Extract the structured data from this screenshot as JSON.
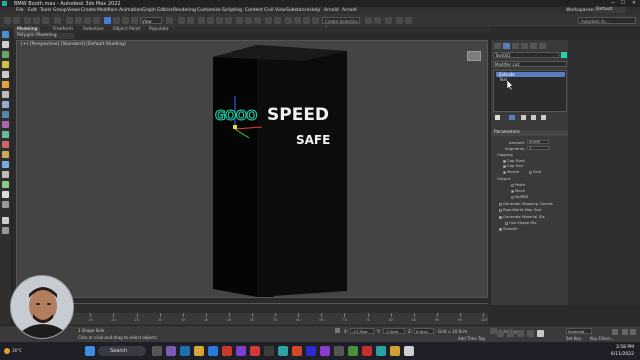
{
  "window": {
    "title": "BMW Booth.max - Autodesk 3ds Max 2022",
    "minimize": "—",
    "maximize": "☐",
    "close": "✕"
  },
  "menu": {
    "items": [
      "File",
      "Edit",
      "Tools",
      "Group",
      "Views",
      "Create",
      "Modifiers",
      "Animation",
      "Graph Editors",
      "Rendering",
      "Customize",
      "Scripting",
      "Content",
      "Civil View",
      "Substance",
      "Help",
      "Arnold",
      "Arnold"
    ],
    "workspaces_label": "Workspaces:",
    "workspaces_value": "Default"
  },
  "toolbar": {
    "view_dropdown": "View",
    "named_selection": "Create Selection Se",
    "search_placeholder": "Autodesk Ac..."
  },
  "ribbon": {
    "tabs": [
      "Modeling",
      "Freeform",
      "Selection",
      "Object Paint",
      "Populate"
    ],
    "active": "Modeling",
    "panel_label": "Polygon Modeling"
  },
  "viewport": {
    "label": "[+] [Perspective] [Standard] [Default Shading]",
    "text_green": "GOOO",
    "text_speed": "SPEED",
    "text_safe": "SAFE"
  },
  "command_panel": {
    "object_name": "Text001",
    "object_color": "#1fd7a8",
    "modifier_list": "Modifier List",
    "stack": [
      "Extrude",
      "Text"
    ],
    "stack_selected": "Extrude",
    "parameters": {
      "header": "Parameters",
      "amount_label": "Amount:",
      "amount_value": "4.0cm",
      "segments_label": "Segments:",
      "segments_value": "1",
      "capping_label": "Capping",
      "cap_start": "Cap Start",
      "cap_end": "Cap End",
      "morph": "Morph",
      "grid": "Grid",
      "output_label": "Output",
      "patch": "Patch",
      "mesh": "Mesh",
      "nurbs": "NURBS",
      "gen_mapping": "Generate Mapping Coords.",
      "real_world": "Real-World Map Size",
      "gen_matids": "Generate Material IDs",
      "use_shape_ids": "Use Shape IDs",
      "smooth": "Smooth"
    }
  },
  "timeline": {
    "frame": "0 / 100",
    "ticks": [
      "0",
      "5",
      "10",
      "15",
      "20",
      "25",
      "30",
      "35",
      "40",
      "45",
      "50",
      "55",
      "60",
      "65",
      "70",
      "75",
      "80",
      "85",
      "90",
      "95",
      "100"
    ]
  },
  "status": {
    "selection": "1 Shape Sele",
    "hint": "Click or click-and-drag to select objects",
    "x_label": "X:",
    "x_value": "-17.3cm",
    "y_label": "Y:",
    "y_value": "-2.0cm",
    "z_label": "Z:",
    "z_value": "0.0cm",
    "grid": "Grid = 10.0cm",
    "add_time_tag": "Add Time Tag",
    "auto_key": "Auto Key",
    "selected": "Selected",
    "set_key": "Set Key",
    "key_filters": "Key Filters..."
  },
  "taskbar": {
    "weather": "16°C",
    "search": "Search",
    "time": "3:58 PM",
    "date": "6/11/2022"
  }
}
